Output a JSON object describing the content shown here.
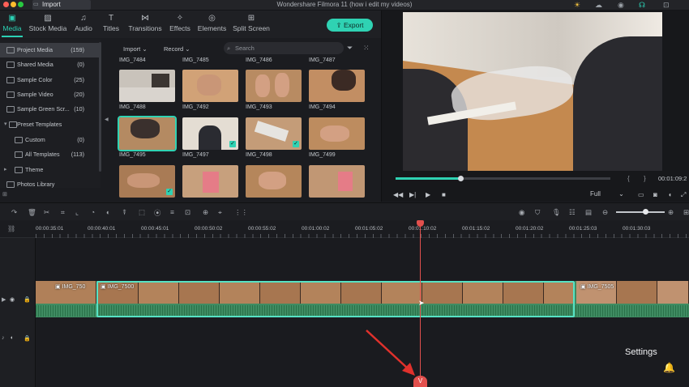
{
  "app": {
    "window_title": "Wondershare Filmora 11 (how i edit my videos)",
    "import_tab": "Import"
  },
  "media_tabs": [
    {
      "label": "Media",
      "icon": "media-icon",
      "active": true
    },
    {
      "label": "Stock Media",
      "icon": "stock-media-icon"
    },
    {
      "label": "Audio",
      "icon": "music-note-icon"
    },
    {
      "label": "Titles",
      "icon": "titles-icon"
    },
    {
      "label": "Transitions",
      "icon": "transitions-icon"
    },
    {
      "label": "Effects",
      "icon": "effects-icon"
    },
    {
      "label": "Elements",
      "icon": "elements-icon"
    },
    {
      "label": "Split Screen",
      "icon": "split-screen-icon"
    }
  ],
  "export_label": "Export",
  "sidebar": [
    {
      "label": "Project Media",
      "count": "(159)",
      "selected": true
    },
    {
      "label": "Shared Media",
      "count": "(0)"
    },
    {
      "label": "Sample Color",
      "count": "(25)"
    },
    {
      "label": "Sample Video",
      "count": "(20)"
    },
    {
      "label": "Sample Green Scr...",
      "count": "(10)"
    },
    {
      "label": "Preset Templates",
      "count": ""
    },
    {
      "label": "Custom",
      "count": "(0)"
    },
    {
      "label": "All Templates",
      "count": "(113)"
    },
    {
      "label": "Theme",
      "count": ""
    },
    {
      "label": "Photos Library",
      "count": ""
    }
  ],
  "media_toolbar": {
    "import_label": "Import",
    "record_label": "Record",
    "search_placeholder": "Search"
  },
  "media_grid": {
    "top_labels": [
      "IMG_7484",
      "IMG_7485",
      "IMG_7486",
      "IMG_7487"
    ],
    "rows": [
      [
        "IMG_7488",
        "IMG_7492",
        "IMG_7493",
        "IMG_7494"
      ],
      [
        "IMG_7495",
        "IMG_7497",
        "IMG_7498",
        "IMG_7499"
      ],
      [
        "",
        "",
        "",
        ""
      ]
    ]
  },
  "preview": {
    "timecode": "00:01:09:2",
    "quality": "Full"
  },
  "ruler_labels": [
    "00:00:35:01",
    "00:00:40:01",
    "00:00:45:01",
    "00:00:50:02",
    "00:00:55:02",
    "00:01:00:02",
    "00:01:05:02",
    "00:01:10:02",
    "00:01:15:02",
    "00:01:20:02",
    "00:01:25:03",
    "00:01:30:03"
  ],
  "timeline": {
    "clip_left": "IMG_750",
    "clip_main": "IMG_7500",
    "clip_right": "IMG_7505",
    "playhead_label": "V",
    "settings_label": "Settings"
  }
}
